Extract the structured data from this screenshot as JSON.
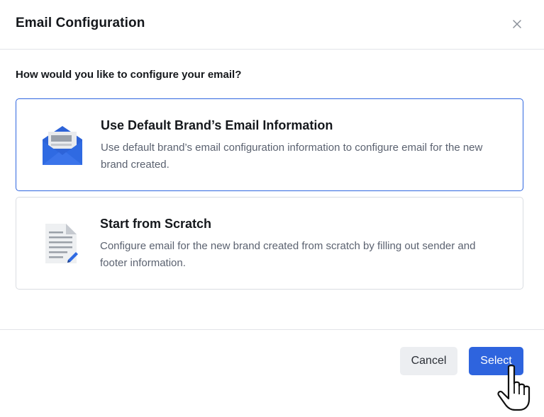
{
  "dialog": {
    "title": "Email Configuration",
    "close_icon": "close-icon"
  },
  "question": "How would you like to configure your email?",
  "options": [
    {
      "icon": "envelope-icon",
      "title": "Use Default Brand’s Email Information",
      "description": "Use default brand’s email configuration information to configure email for the new brand created.",
      "selected": true
    },
    {
      "icon": "document-edit-icon",
      "title": "Start from Scratch",
      "description": "Configure email for the new brand created from scratch by filling out sender and footer information.",
      "selected": false
    }
  ],
  "footer": {
    "cancel_label": "Cancel",
    "select_label": "Select"
  },
  "colors": {
    "accent": "#2e64de",
    "selected_border": "#2f66e0",
    "cancel_bg": "#eceef1"
  }
}
